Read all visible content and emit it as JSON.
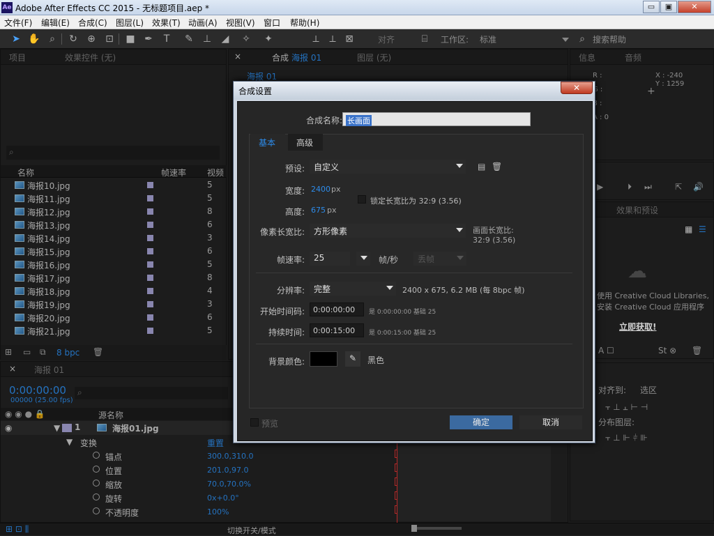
{
  "window": {
    "title": "Adobe After Effects CC 2015 - 无标题项目.aep *",
    "logo": "Ae",
    "min": "▭",
    "max": "▣",
    "close": "✕"
  },
  "menu": [
    "文件(F)",
    "编辑(E)",
    "合成(C)",
    "图层(L)",
    "效果(T)",
    "动画(A)",
    "视图(V)",
    "窗口",
    "帮助(H)"
  ],
  "toolbar": {
    "align": "对齐",
    "workspace_label": "工作区:",
    "workspace": "标准",
    "search": "搜索帮助"
  },
  "project_panel": {
    "tab_project": "项目",
    "tab_effects": "效果控件 (无)",
    "col_name": "名称",
    "col_fps": "帧速率",
    "col_video": "视频",
    "files": [
      {
        "name": "海报10.jpg",
        "n": "5"
      },
      {
        "name": "海报11.jpg",
        "n": "5"
      },
      {
        "name": "海报12.jpg",
        "n": "8"
      },
      {
        "name": "海报13.jpg",
        "n": "6"
      },
      {
        "name": "海报14.jpg",
        "n": "3"
      },
      {
        "name": "海报15.jpg",
        "n": "6"
      },
      {
        "name": "海报16.jpg",
        "n": "5"
      },
      {
        "name": "海报17.jpg",
        "n": "8"
      },
      {
        "name": "海报18.jpg",
        "n": "4"
      },
      {
        "name": "海报19.jpg",
        "n": "3"
      },
      {
        "name": "海报20.jpg",
        "n": "6"
      },
      {
        "name": "海报21.jpg",
        "n": "5"
      }
    ],
    "bpc": "8 bpc"
  },
  "comp_panel": {
    "tab_comp": "合成",
    "comp_name": "海报 01",
    "layer_tab": "图层 (无)",
    "crumb": "海报 01"
  },
  "info_panel": {
    "tab_info": "信息",
    "tab_audio": "音频",
    "r": "R :",
    "g": "G :",
    "b": "B :",
    "a": "A : 0",
    "x": "X : -240",
    "y": "Y : 1259"
  },
  "effects_panel": {
    "tab": "效果和预设",
    "cc_line1": "使用 Creative Cloud Libraries,",
    "cc_line2": "安装 Creative Cloud 应用程序",
    "cc_link": "立即获取!"
  },
  "align_panel": {
    "align_to": "对齐到:",
    "selection": "选区",
    "distribute": "分布图层:"
  },
  "timeline": {
    "comp_tab": "海报 01",
    "timecode": "0:00:00:00",
    "frames": "00000 (25.00 fps)",
    "col_source": "源名称",
    "layer_num": "1",
    "layer_name": "海报01.jpg",
    "transform": "变换",
    "reset": "重置",
    "props": [
      {
        "name": "锚点",
        "value": "300.0,310.0"
      },
      {
        "name": "位置",
        "value": "201.0,97.0"
      },
      {
        "name": "缩放",
        "value": "70.0,70.0%"
      },
      {
        "name": "旋转",
        "value": "0x+0.0°"
      },
      {
        "name": "不透明度",
        "value": "100%"
      }
    ],
    "toggle": "切换开关/模式"
  },
  "dialog": {
    "title": "合成设置",
    "name_label": "合成名称:",
    "name_value": "长画面",
    "tab_basic": "基本",
    "tab_advanced": "高级",
    "preset_label": "预设:",
    "preset_value": "自定义",
    "width_label": "宽度:",
    "width_value": "2400",
    "px": "px",
    "height_label": "高度:",
    "height_value": "675",
    "lock_label": "锁定长宽比为 32:9 (3.56)",
    "par_label": "像素长宽比:",
    "par_value": "方形像素",
    "frame_ar_label": "画面长宽比:",
    "frame_ar_value": "32:9 (3.56)",
    "fps_label": "帧速率:",
    "fps_value": "25",
    "fps_unit": "帧/秒",
    "drop_frame": "丢帧",
    "res_label": "分辨率:",
    "res_value": "完整",
    "res_info": "2400 x 675, 6.2 MB (每 8bpc 帧)",
    "start_label": "开始时间码:",
    "start_value": "0:00:00:00",
    "start_info": "是 0:00:00:00  基础 25",
    "dur_label": "持续时间:",
    "dur_value": "0:00:15:00",
    "dur_info": "是 0:00:15:00  基础 25",
    "bg_label": "背景颜色:",
    "bg_name": "黑色",
    "bg_color": "#000000",
    "preview": "预览",
    "ok": "确定",
    "cancel": "取消"
  }
}
